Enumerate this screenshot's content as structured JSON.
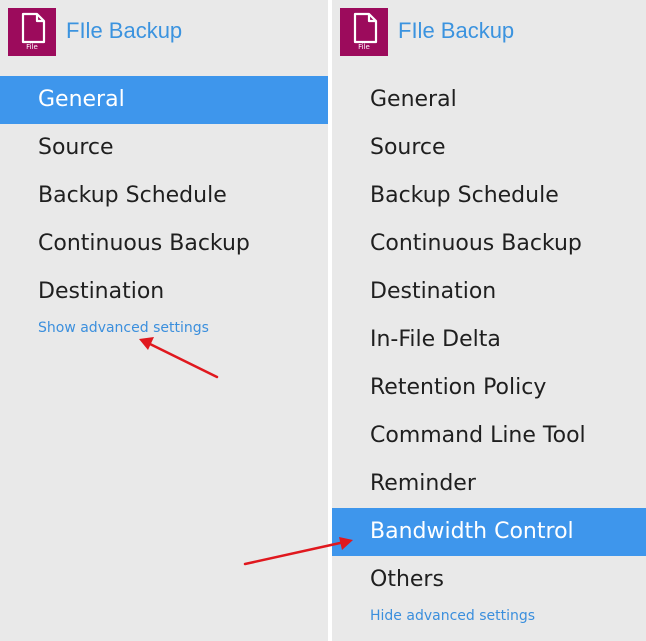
{
  "app": {
    "title": "FIle Backup",
    "icon_label": "File",
    "icon_name": "file-icon",
    "icon_color": "#9c0b5c"
  },
  "left_panel": {
    "nav": [
      {
        "label": "General",
        "selected": true
      },
      {
        "label": "Source"
      },
      {
        "label": "Backup Schedule"
      },
      {
        "label": "Continuous Backup"
      },
      {
        "label": "Destination"
      }
    ],
    "advanced_link": "Show advanced settings"
  },
  "right_panel": {
    "nav": [
      {
        "label": "General"
      },
      {
        "label": "Source"
      },
      {
        "label": "Backup Schedule"
      },
      {
        "label": "Continuous Backup"
      },
      {
        "label": "Destination"
      },
      {
        "label": "In-File Delta"
      },
      {
        "label": "Retention Policy"
      },
      {
        "label": "Command Line Tool"
      },
      {
        "label": "Reminder"
      },
      {
        "label": "Bandwidth Control",
        "selected": true
      },
      {
        "label": "Others"
      }
    ],
    "advanced_link": "Hide advanced settings"
  },
  "colors": {
    "selected_background": "#3e96ec",
    "link": "#3b8fdd",
    "annotation_arrow": "#e0181e"
  }
}
